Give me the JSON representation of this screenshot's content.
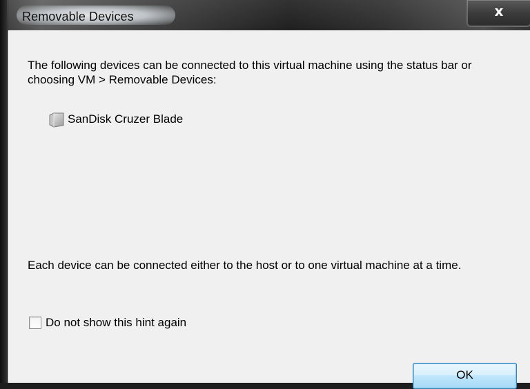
{
  "window": {
    "title": "Removable Devices",
    "close_label": "x"
  },
  "dialog": {
    "intro_text": "The following devices can be connected to this virtual machine using the status bar or choosing VM > Removable Devices:",
    "devices": [
      {
        "label": "SanDisk Cruzer Blade",
        "icon": "usb-drive-icon"
      }
    ],
    "note_text": "Each device can be connected either to the host or to one virtual machine at a time.",
    "hint_checkbox": {
      "label": "Do not show this hint again",
      "checked": false
    },
    "ok_label": "OK"
  },
  "colors": {
    "client_background": "#f0f0f0",
    "ok_button_border": "#3c7fb1",
    "ok_button_fill": "#bee6fd"
  }
}
